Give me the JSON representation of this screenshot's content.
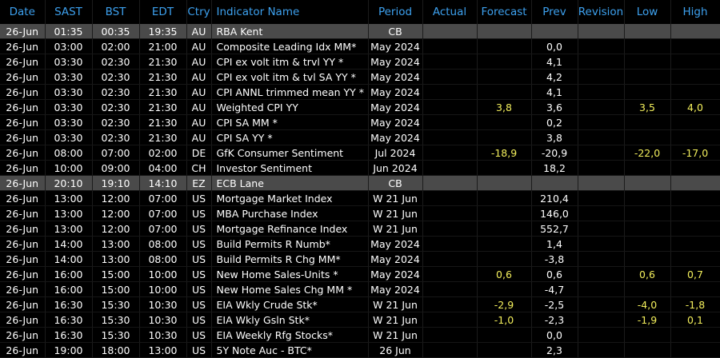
{
  "columns": [
    "Date",
    "SAST",
    "BST",
    "EDT",
    "Ctry",
    "Indicator Name",
    "Period",
    "Actual",
    "Forecast",
    "Prev",
    "Revision",
    "Low",
    "High"
  ],
  "rows": [
    {
      "date": "26-Jun",
      "sast": "01:35",
      "bst": "00:35",
      "edt": "19:35",
      "ctry": "AU",
      "name": "RBA Kent",
      "period": "CB",
      "actual": "",
      "forecast": "",
      "prev": "",
      "revision": "",
      "low": "",
      "high": "",
      "highlight": true
    },
    {
      "date": "26-Jun",
      "sast": "03:00",
      "bst": "02:00",
      "edt": "21:00",
      "ctry": "AU",
      "name": "Composite Leading Idx MM*",
      "period": "May 2024",
      "actual": "",
      "forecast": "",
      "prev": "0,0",
      "revision": "",
      "low": "",
      "high": ""
    },
    {
      "date": "26-Jun",
      "sast": "03:30",
      "bst": "02:30",
      "edt": "21:30",
      "ctry": "AU",
      "name": "CPI ex volt itm & trvl YY *",
      "period": "May 2024",
      "actual": "",
      "forecast": "",
      "prev": "4,1",
      "revision": "",
      "low": "",
      "high": ""
    },
    {
      "date": "26-Jun",
      "sast": "03:30",
      "bst": "02:30",
      "edt": "21:30",
      "ctry": "AU",
      "name": "CPI ex volt itm & tvl SA YY *",
      "period": "May 2024",
      "actual": "",
      "forecast": "",
      "prev": "4,2",
      "revision": "",
      "low": "",
      "high": ""
    },
    {
      "date": "26-Jun",
      "sast": "03:30",
      "bst": "02:30",
      "edt": "21:30",
      "ctry": "AU",
      "name": "CPI ANNL trimmed mean YY *",
      "period": "May 2024",
      "actual": "",
      "forecast": "",
      "prev": "4,1",
      "revision": "",
      "low": "",
      "high": ""
    },
    {
      "date": "26-Jun",
      "sast": "03:30",
      "bst": "02:30",
      "edt": "21:30",
      "ctry": "AU",
      "name": "Weighted CPI YY",
      "period": "May 2024",
      "actual": "",
      "forecast": "3,8",
      "prev": "3,6",
      "revision": "",
      "low": "3,5",
      "high": "4,0"
    },
    {
      "date": "26-Jun",
      "sast": "03:30",
      "bst": "02:30",
      "edt": "21:30",
      "ctry": "AU",
      "name": "CPI SA MM *",
      "period": "May 2024",
      "actual": "",
      "forecast": "",
      "prev": "0,2",
      "revision": "",
      "low": "",
      "high": ""
    },
    {
      "date": "26-Jun",
      "sast": "03:30",
      "bst": "02:30",
      "edt": "21:30",
      "ctry": "AU",
      "name": "CPI SA YY *",
      "period": "May 2024",
      "actual": "",
      "forecast": "",
      "prev": "3,8",
      "revision": "",
      "low": "",
      "high": ""
    },
    {
      "date": "26-Jun",
      "sast": "08:00",
      "bst": "07:00",
      "edt": "02:00",
      "ctry": "DE",
      "name": "GfK Consumer Sentiment",
      "period": "Jul 2024",
      "actual": "",
      "forecast": "-18,9",
      "prev": "-20,9",
      "revision": "",
      "low": "-22,0",
      "high": "-17,0"
    },
    {
      "date": "26-Jun",
      "sast": "10:00",
      "bst": "09:00",
      "edt": "04:00",
      "ctry": "CH",
      "name": "Investor Sentiment",
      "period": "Jun 2024",
      "actual": "",
      "forecast": "",
      "prev": "18,2",
      "revision": "",
      "low": "",
      "high": ""
    },
    {
      "date": "26-Jun",
      "sast": "20:10",
      "bst": "19:10",
      "edt": "14:10",
      "ctry": "EZ",
      "name": "ECB Lane",
      "period": "CB",
      "actual": "",
      "forecast": "",
      "prev": "",
      "revision": "",
      "low": "",
      "high": "",
      "highlight": true
    },
    {
      "date": "26-Jun",
      "sast": "13:00",
      "bst": "12:00",
      "edt": "07:00",
      "ctry": "US",
      "name": "Mortgage Market Index",
      "period": "W 21 Jun",
      "actual": "",
      "forecast": "",
      "prev": "210,4",
      "revision": "",
      "low": "",
      "high": ""
    },
    {
      "date": "26-Jun",
      "sast": "13:00",
      "bst": "12:00",
      "edt": "07:00",
      "ctry": "US",
      "name": "MBA Purchase Index",
      "period": "W 21 Jun",
      "actual": "",
      "forecast": "",
      "prev": "146,0",
      "revision": "",
      "low": "",
      "high": ""
    },
    {
      "date": "26-Jun",
      "sast": "13:00",
      "bst": "12:00",
      "edt": "07:00",
      "ctry": "US",
      "name": "Mortgage Refinance Index",
      "period": "W 21 Jun",
      "actual": "",
      "forecast": "",
      "prev": "552,7",
      "revision": "",
      "low": "",
      "high": ""
    },
    {
      "date": "26-Jun",
      "sast": "14:00",
      "bst": "13:00",
      "edt": "08:00",
      "ctry": "US",
      "name": "Build Permits R Numb*",
      "period": "May 2024",
      "actual": "",
      "forecast": "",
      "prev": "1,4",
      "revision": "",
      "low": "",
      "high": ""
    },
    {
      "date": "26-Jun",
      "sast": "14:00",
      "bst": "13:00",
      "edt": "08:00",
      "ctry": "US",
      "name": "Build Permits R Chg MM*",
      "period": "May 2024",
      "actual": "",
      "forecast": "",
      "prev": "-3,8",
      "revision": "",
      "low": "",
      "high": ""
    },
    {
      "date": "26-Jun",
      "sast": "16:00",
      "bst": "15:00",
      "edt": "10:00",
      "ctry": "US",
      "name": "New Home Sales-Units *",
      "period": "May 2024",
      "actual": "",
      "forecast": "0,6",
      "prev": "0,6",
      "revision": "",
      "low": "0,6",
      "high": "0,7"
    },
    {
      "date": "26-Jun",
      "sast": "16:00",
      "bst": "15:00",
      "edt": "10:00",
      "ctry": "US",
      "name": "New Home Sales Chg MM *",
      "period": "May 2024",
      "actual": "",
      "forecast": "",
      "prev": "-4,7",
      "revision": "",
      "low": "",
      "high": ""
    },
    {
      "date": "26-Jun",
      "sast": "16:30",
      "bst": "15:30",
      "edt": "10:30",
      "ctry": "US",
      "name": "EIA Wkly Crude Stk*",
      "period": "W 21 Jun",
      "actual": "",
      "forecast": "-2,9",
      "prev": "-2,5",
      "revision": "",
      "low": "-4,0",
      "high": "-1,8"
    },
    {
      "date": "26-Jun",
      "sast": "16:30",
      "bst": "15:30",
      "edt": "10:30",
      "ctry": "US",
      "name": "EIA Wkly Gsln Stk*",
      "period": "W 21 Jun",
      "actual": "",
      "forecast": "-1,0",
      "prev": "-2,3",
      "revision": "",
      "low": "-1,9",
      "high": "0,1"
    },
    {
      "date": "26-Jun",
      "sast": "16:30",
      "bst": "15:30",
      "edt": "10:30",
      "ctry": "US",
      "name": "EIA Weekly Rfg Stocks*",
      "period": "W 21 Jun",
      "actual": "",
      "forecast": "",
      "prev": "0,0",
      "revision": "",
      "low": "",
      "high": ""
    },
    {
      "date": "26-Jun",
      "sast": "19:00",
      "bst": "18:00",
      "edt": "13:00",
      "ctry": "US",
      "name": "5Y Note Auc - BTC*",
      "period": "26 Jun",
      "actual": "",
      "forecast": "",
      "prev": "2,3",
      "revision": "",
      "low": "",
      "high": ""
    }
  ]
}
